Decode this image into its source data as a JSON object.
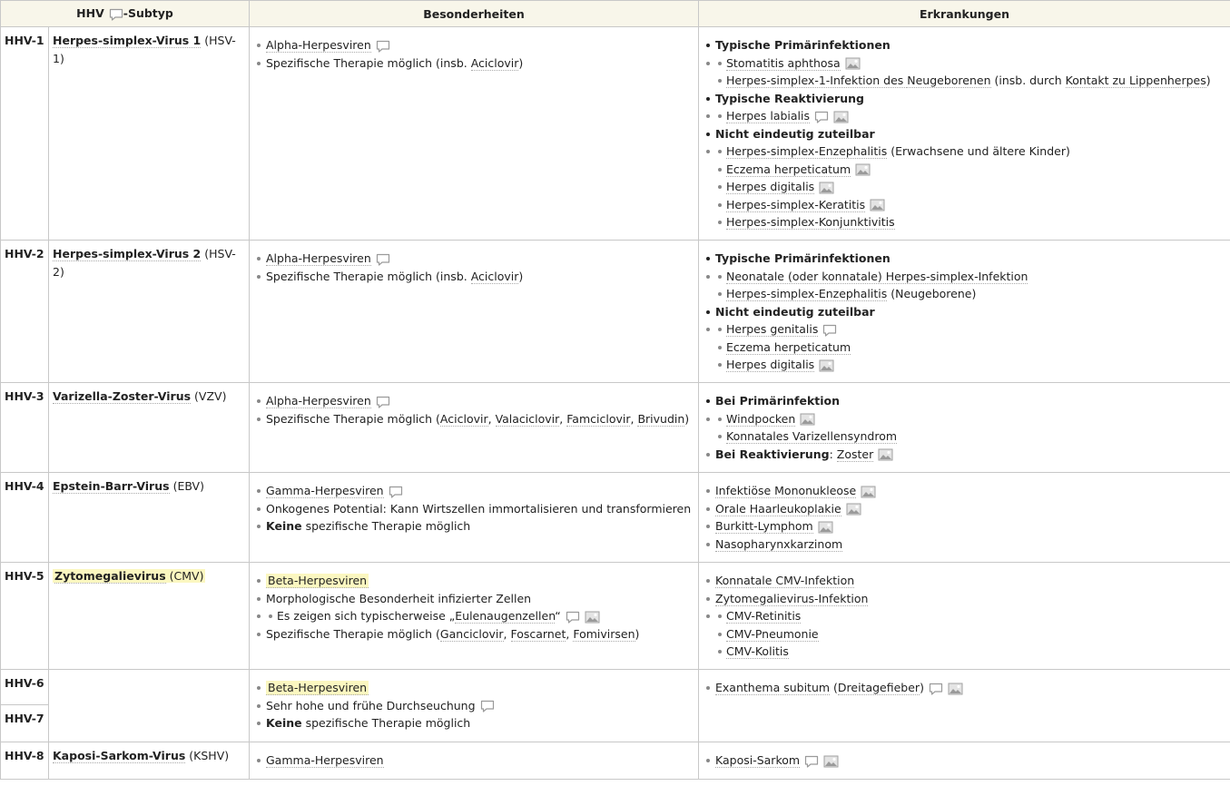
{
  "header": {
    "col1_pre": "HHV",
    "col1_post": "-Subtyp",
    "col2": "Besonderheiten",
    "col3": "Erkrankungen"
  },
  "icons": {
    "comment": "comment-icon",
    "image": "image-icon"
  },
  "rows": [
    {
      "id": "HHV-1",
      "virus": "Herpes-simplex-Virus 1",
      "abbr": "(HSV-1)",
      "bes": [
        "Alpha-Herpesviren",
        "Spezifische Therapie möglich (insb. ",
        "Aciclovir",
        ")"
      ],
      "erk": {
        "h1": "Typische Primärinfektionen",
        "a": "Stomatitis aphthosa",
        "b1": "Herpes-simplex-1-Infektion des ",
        "b2": "Neugeborenen",
        "b3": " (insb. durch ",
        "b4": "Kontakt zu Lippenherpes",
        "b5": ")",
        "h2": "Typische Reaktivierung",
        "c": "Herpes labialis",
        "h3": "Nicht eindeutig zuteilbar",
        "d1": "Herpes-simplex-Enzephalitis",
        "d2": " (Erwachsene und ältere Kinder)",
        "e": "Eczema herpeticatum",
        "f": "Herpes digitalis",
        "g": "Herpes-simplex-Keratitis",
        "h": "Herpes-simplex-Konjunktivitis"
      }
    },
    {
      "id": "HHV-2",
      "virus": "Herpes-simplex-Virus 2",
      "abbr": "(HSV-2)",
      "bes": [
        "Alpha-Herpesviren",
        "Spezifische Therapie möglich (insb. ",
        "Aciclovir",
        ")"
      ],
      "erk": {
        "h1": "Typische Primärinfektionen",
        "a": "Neonatale (oder konnatale) Herpes-simplex-Infektion",
        "b1": "Herpes-simplex-Enzephalitis",
        "b2": " (Neugeborene)",
        "h2": "Nicht eindeutig zuteilbar",
        "c": "Herpes genitalis",
        "d": "Eczema herpeticatum",
        "e": "Herpes digitalis"
      }
    },
    {
      "id": "HHV-3",
      "virus": "Varizella-Zoster-Virus",
      "abbr": "(VZV)",
      "bes": [
        "Alpha-Herpesviren",
        "Spezifische Therapie möglich (",
        "Aciclovir",
        ", ",
        "Valaciclovir",
        ", ",
        "Famciclovir",
        ", ",
        "Brivudin",
        ")"
      ],
      "erk": {
        "h1": "Bei Primärinfektion",
        "a": "Windpocken",
        "b": "Konnatales Varizellensyndrom",
        "h2": "Bei Reaktivierung",
        "h2sep": ": ",
        "c": "Zoster"
      }
    },
    {
      "id": "HHV-4",
      "virus": "Epstein-Barr-Virus",
      "abbr": "(EBV)",
      "bes": [
        "Gamma-Herpesviren",
        "Onkogenes Potential: Kann Wirtszellen immortalisieren und transformieren",
        "Keine",
        " spezifische Therapie möglich"
      ],
      "erk": [
        "Infektiöse Mononukleose",
        "Orale Haarleukoplakie",
        "Burkitt-Lymphom",
        "Nasopharynxkarzinom"
      ]
    },
    {
      "id": "HHV-5",
      "virus": "Zytomegalievirus",
      "abbr": "(CMV)",
      "bes": [
        "Beta-Herpesviren",
        "Morphologische Besonderheit infizierter Zellen",
        "Es zeigen sich typischerweise „",
        "Eulenaugenzellen",
        "“",
        "Spezifische Therapie möglich (",
        "Ganciclovir",
        ", ",
        "Foscarnet",
        ", ",
        "Fomivirsen",
        ")"
      ],
      "erk": [
        "Konnatale CMV-Infektion",
        "Zytomegalievirus-Infektion",
        "CMV-Retinitis",
        "CMV-Pneumonie",
        "CMV-Kolitis"
      ]
    },
    {
      "id": "HHV-6",
      "id2": "HHV-7",
      "bes": [
        "Beta-Herpesviren",
        "Sehr hohe und frühe Durchseuchung",
        "Keine",
        " spezifische Therapie möglich"
      ],
      "erk": [
        "Exanthema subitum",
        "Dreitagefieber"
      ]
    },
    {
      "id": "HHV-8",
      "virus": "Kaposi-Sarkom-Virus",
      "abbr": "(KSHV)",
      "bes": [
        "Gamma-Herpesviren"
      ],
      "erk": [
        "Kaposi-Sarkom"
      ]
    }
  ]
}
